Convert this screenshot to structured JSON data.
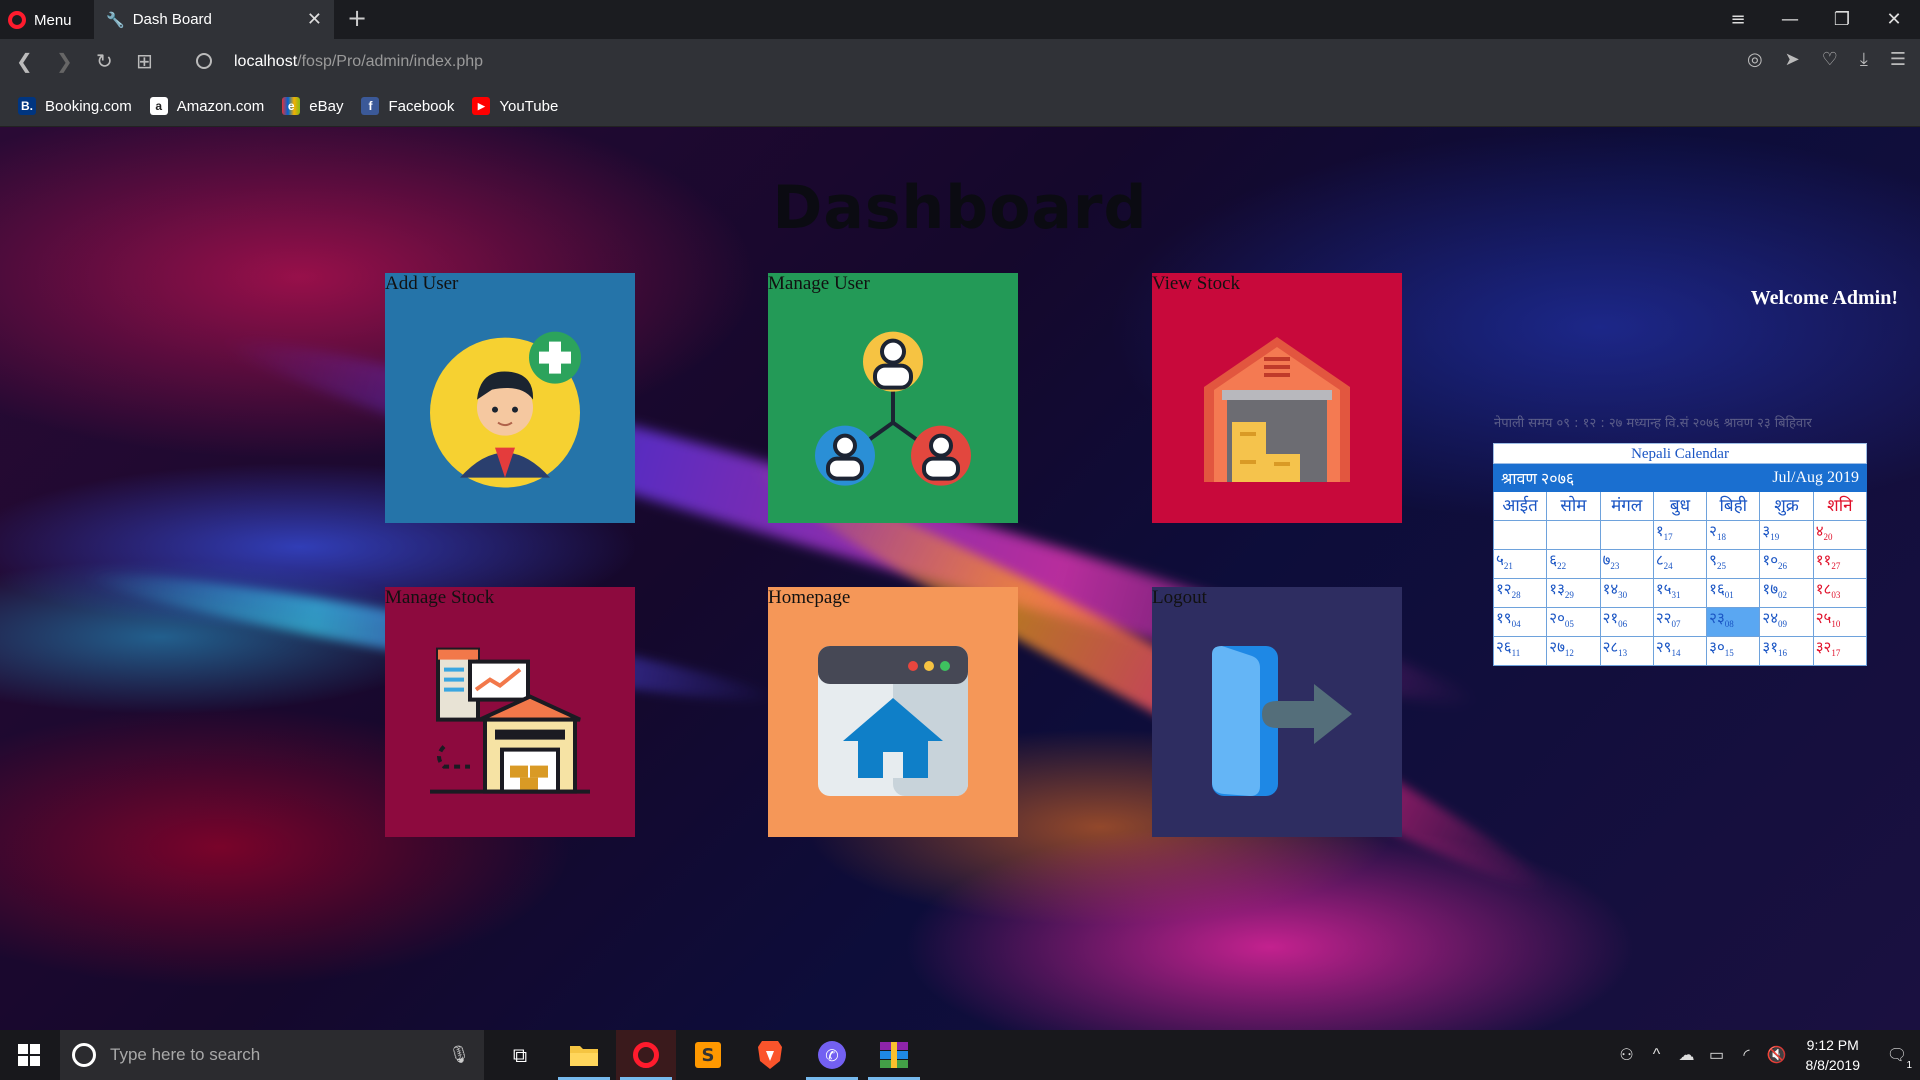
{
  "browser": {
    "menu_label": "Menu",
    "tab_title": "Dash Board",
    "url_host": "localhost",
    "url_path": "/fosp/Pro/admin/index.php",
    "bookmarks": [
      {
        "label": "Booking.com",
        "icon": "B.",
        "color": "#003580"
      },
      {
        "label": "Amazon.com",
        "icon": "a",
        "color": "#222222"
      },
      {
        "label": "eBay",
        "icon": "e",
        "color": "#e53238"
      },
      {
        "label": "Facebook",
        "icon": "f",
        "color": "#3b5998"
      },
      {
        "label": "YouTube",
        "icon": "▶",
        "color": "#ff0000"
      }
    ]
  },
  "page": {
    "title": "Dashboard",
    "welcome": "Welcome Admin!",
    "nepali_time": "नेपाली समय ०९ : १२ : २७ मध्यान्ह   वि.सं २०७६ श्रावण २३ बिहिवार",
    "cards": [
      {
        "label": "Add User",
        "color": "#2574a9",
        "icon": "add-user-icon"
      },
      {
        "label": "Manage User",
        "color": "#239a57",
        "icon": "manage-user-icon"
      },
      {
        "label": "View Stock",
        "color": "#c8093b",
        "icon": "warehouse-icon"
      },
      {
        "label": "Manage Stock",
        "color": "#8d0a3e",
        "icon": "manage-stock-icon"
      },
      {
        "label": "Homepage",
        "color": "#f59758",
        "icon": "home-icon"
      },
      {
        "label": "Logout",
        "color": "#2e2d61",
        "icon": "logout-icon"
      }
    ]
  },
  "calendar": {
    "title": "Nepali Calendar",
    "month": "श्रावण २०७६",
    "gregorian": "Jul/Aug 2019",
    "weekdays": [
      "आईत",
      "सोम",
      "मंगल",
      "बुध",
      "बिही",
      "शुक्र",
      "शनि"
    ],
    "weeks": [
      [
        null,
        null,
        null,
        [
          "१",
          "17"
        ],
        [
          "२",
          "18"
        ],
        [
          "३",
          "19"
        ],
        [
          "४",
          "20"
        ]
      ],
      [
        [
          "५",
          "21"
        ],
        [
          "६",
          "22"
        ],
        [
          "७",
          "23"
        ],
        [
          "८",
          "24"
        ],
        [
          "९",
          "25"
        ],
        [
          "१०",
          "26"
        ],
        [
          "११",
          "27"
        ]
      ],
      [
        [
          "१२",
          "28"
        ],
        [
          "१३",
          "29"
        ],
        [
          "१४",
          "30"
        ],
        [
          "१५",
          "31"
        ],
        [
          "१६",
          "01"
        ],
        [
          "१७",
          "02"
        ],
        [
          "१८",
          "03"
        ]
      ],
      [
        [
          "१९",
          "04"
        ],
        [
          "२०",
          "05"
        ],
        [
          "२१",
          "06"
        ],
        [
          "२२",
          "07"
        ],
        [
          "२३",
          "08"
        ],
        [
          "२४",
          "09"
        ],
        [
          "२५",
          "10"
        ]
      ],
      [
        [
          "२६",
          "11"
        ],
        [
          "२७",
          "12"
        ],
        [
          "२८",
          "13"
        ],
        [
          "२९",
          "14"
        ],
        [
          "३०",
          "15"
        ],
        [
          "३१",
          "16"
        ],
        [
          "३२",
          "17"
        ]
      ]
    ],
    "today": "२३"
  },
  "taskbar": {
    "search_placeholder": "Type here to search",
    "time": "9:12 PM",
    "date": "8/8/2019",
    "notification_count": "1"
  }
}
